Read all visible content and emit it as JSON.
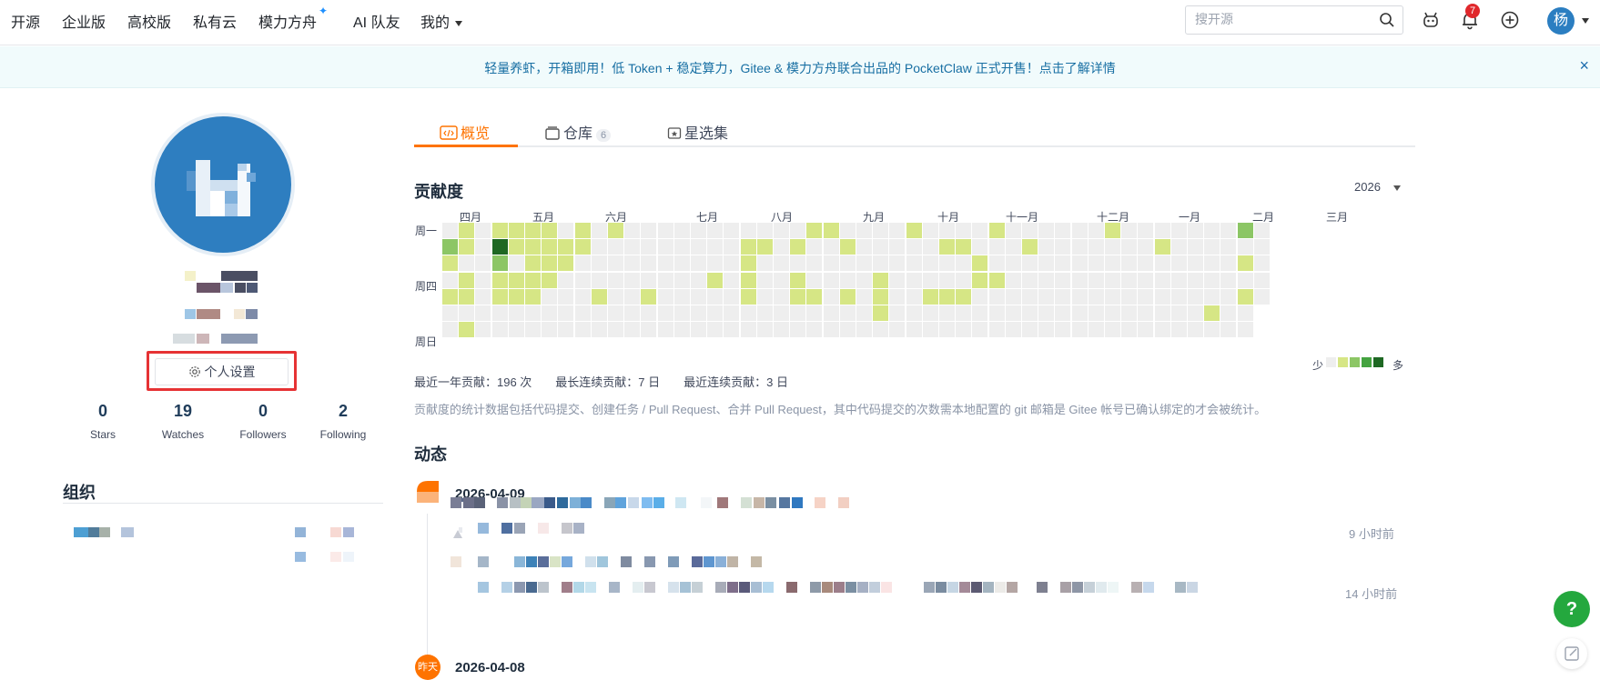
{
  "nav": {
    "items": [
      {
        "label": "开源"
      },
      {
        "label": "企业版"
      },
      {
        "label": "高校版"
      },
      {
        "label": "私有云"
      },
      {
        "label": "模力方舟"
      },
      {
        "label": "AI 队友"
      },
      {
        "label": "我的"
      }
    ],
    "search_placeholder": "搜开源",
    "notification_count": "7",
    "avatar_text": "杨"
  },
  "announcement": {
    "text": "轻量养虾，开箱即用！低 Token + 稳定算力，Gitee & 模力方舟联合出品的 PocketClaw 正式开售！点击了解详情",
    "close": "×"
  },
  "profile": {
    "settings_label": "个人设置",
    "stats": [
      {
        "value": "0",
        "label": "Stars"
      },
      {
        "value": "19",
        "label": "Watches"
      },
      {
        "value": "0",
        "label": "Followers"
      },
      {
        "value": "2",
        "label": "Following"
      }
    ],
    "org_title": "组织"
  },
  "tabs": [
    {
      "label": "概览",
      "active": true
    },
    {
      "label": "仓库",
      "count": "6"
    },
    {
      "label": "星选集"
    }
  ],
  "contrib": {
    "title": "贡献度",
    "year": "2026",
    "months": [
      "四月",
      "五月",
      "六月",
      "七月",
      "八月",
      "九月",
      "十月",
      "十一月",
      "十二月",
      "一月",
      "二月",
      "三月"
    ],
    "weekdays": [
      "周一",
      "周四",
      "周日"
    ],
    "legend_less": "少",
    "legend_more": "多",
    "stats": "最近一年贡献：196 次　　最长连续贡献：7 日　　最近连续贡献：3 日",
    "note": "贡献度的统计数据包括代码提交、创建任务 / Pull Request、合并 Pull Request，其中代码提交的次数需本地配置的 git 邮箱是 Gitee 帐号已确认绑定的才会被统计。",
    "colors": {
      "empty": "#eeeeee",
      "l1": "#d6e685",
      "l2": "#8cc665",
      "l3": "#44a340",
      "l4": "#1e6823"
    }
  },
  "activity": {
    "title": "动态",
    "groups": [
      {
        "date": "2026-04-09",
        "entries": [
          {
            "time": "9 小时前"
          },
          {
            "time": "14 小时前"
          }
        ]
      },
      {
        "date": "2026-04-08",
        "badge": "昨天"
      }
    ]
  },
  "help": "?"
}
